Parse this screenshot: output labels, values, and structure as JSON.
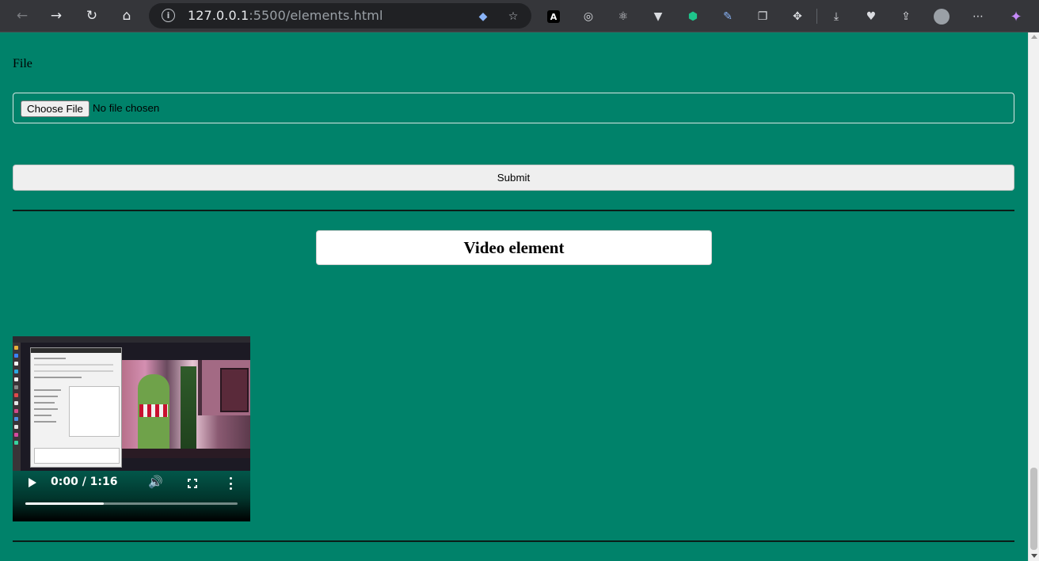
{
  "browser": {
    "url_host": "127.0.0.1",
    "url_rest": ":5500/elements.html",
    "nav": {
      "back_icon": "arrow-left-icon",
      "forward_icon": "arrow-right-icon",
      "reload_icon": "reload-icon",
      "home_icon": "home-icon"
    },
    "extensions": [
      "a-extension-icon",
      "target-icon",
      "react-icon",
      "vue-icon",
      "shield-icon",
      "color-picker-icon",
      "copy-icon",
      "puzzle-icon",
      "download-icon",
      "heartbeat-icon",
      "share-icon",
      "profile-avatar-icon",
      "more-icon",
      "sparkle-icon"
    ],
    "colors": {
      "toolbar": "#35363a",
      "omnibox": "#202124",
      "page_background": "#00826a"
    }
  },
  "form": {
    "file_label": "File",
    "choose_file_label": "Choose File",
    "no_file_text": "No file chosen",
    "submit_label": "Submit"
  },
  "video_section": {
    "heading": "Video element",
    "current_time": "0:00",
    "duration": "1:16",
    "time_display": "0:00 / 1:16",
    "progress_buffered": 0.37
  }
}
